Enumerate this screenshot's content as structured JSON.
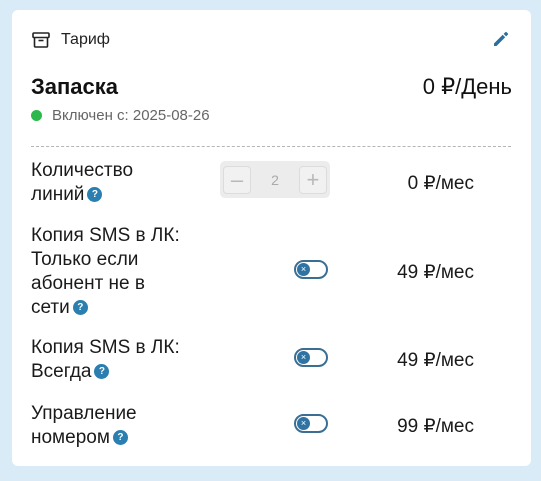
{
  "header": {
    "icon": "archive-box-icon",
    "label": "Тариф",
    "edit_icon": "pencil-icon"
  },
  "plan": {
    "name": "Запаска",
    "price": "0 ₽/День",
    "status_text": "Включен с: 2025-08-26",
    "status_color": "#2db84d"
  },
  "options": [
    {
      "lines": [
        "Количество",
        "линий"
      ],
      "help": "?",
      "control": "stepper",
      "stepper": {
        "minus": "–",
        "value": "2",
        "plus": "+"
      },
      "price": "0 ₽/мес"
    },
    {
      "lines": [
        "Копия SMS в ЛК:",
        "Только если",
        "абонент не в",
        "сети"
      ],
      "help": "?",
      "control": "toggle",
      "toggle": {
        "on": false,
        "knob_glyph": "×"
      },
      "price": "49 ₽/мес"
    },
    {
      "lines": [
        "Копия SMS в ЛК:",
        "Всегда"
      ],
      "help": "?",
      "control": "toggle",
      "toggle": {
        "on": false,
        "knob_glyph": "×"
      },
      "price": "49 ₽/мес"
    },
    {
      "lines": [
        "Управление",
        "номером"
      ],
      "help": "?",
      "control": "toggle",
      "toggle": {
        "on": false,
        "knob_glyph": "×"
      },
      "price": "99 ₽/мес"
    }
  ],
  "colors": {
    "page_bg": "#d8ebf7",
    "card_bg": "#ffffff",
    "accent": "#2a7fb0",
    "toggle_border": "#3a6f93"
  }
}
